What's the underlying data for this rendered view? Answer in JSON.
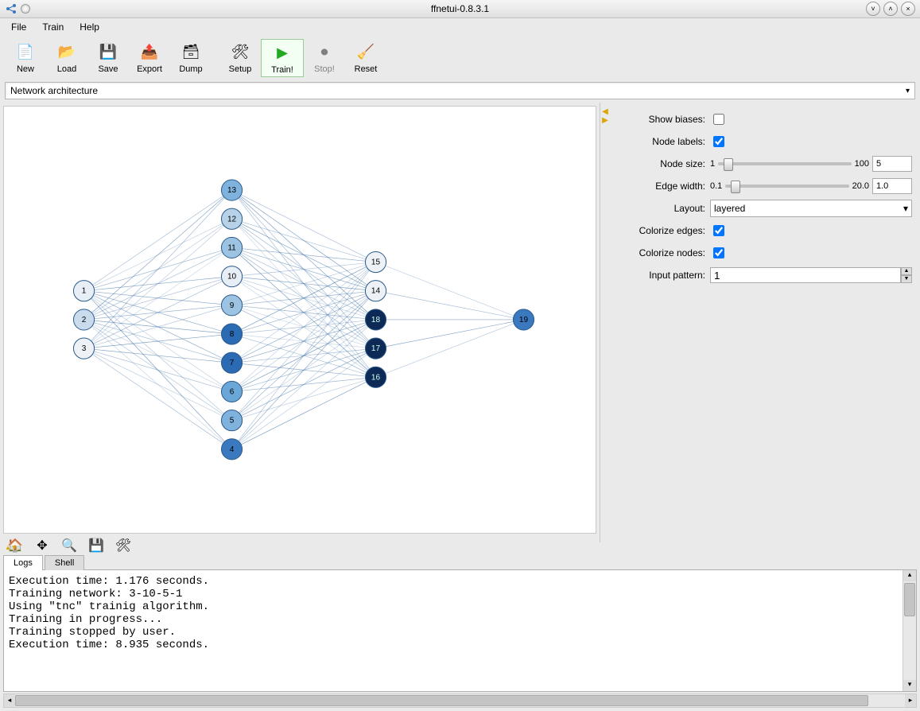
{
  "title": "ffnetui-0.8.3.1",
  "menu": {
    "file": "File",
    "train": "Train",
    "help": "Help"
  },
  "toolbar": {
    "new": "New",
    "load": "Load",
    "save": "Save",
    "export": "Export",
    "dump": "Dump",
    "setup": "Setup",
    "train": "Train!",
    "stop": "Stop!",
    "reset": "Reset"
  },
  "view_selector": "Network architecture",
  "props": {
    "show_biases": {
      "label": "Show biases:",
      "checked": false
    },
    "node_labels": {
      "label": "Node labels:",
      "checked": true
    },
    "node_size": {
      "label": "Node size:",
      "min": "1",
      "max": "100",
      "value": "5"
    },
    "edge_width": {
      "label": "Edge width:",
      "min": "0.1",
      "max": "20.0",
      "value": "1.0"
    },
    "layout": {
      "label": "Layout:",
      "value": "layered"
    },
    "colorize_edges": {
      "label": "Colorize edges:",
      "checked": true
    },
    "colorize_nodes": {
      "label": "Colorize nodes:",
      "checked": true
    },
    "input_pattern": {
      "label": "Input pattern:",
      "value": "1"
    }
  },
  "tabs": {
    "logs": "Logs",
    "shell": "Shell"
  },
  "log": "Execution time: 1.176 seconds.\nTraining network: 3-10-5-1\nUsing \"tnc\" trainig algorithm.\nTraining in progress...\nTraining stopped by user.\nExecution time: 8.935 seconds.",
  "chart_data": {
    "type": "network",
    "layers": [
      {
        "nodes": [
          {
            "id": 1
          },
          {
            "id": 2
          },
          {
            "id": 3
          }
        ]
      },
      {
        "nodes": [
          {
            "id": 4
          },
          {
            "id": 5
          },
          {
            "id": 6
          },
          {
            "id": 7
          },
          {
            "id": 8
          },
          {
            "id": 9
          },
          {
            "id": 10
          },
          {
            "id": 11
          },
          {
            "id": 12
          },
          {
            "id": 13
          }
        ]
      },
      {
        "nodes": [
          {
            "id": 14
          },
          {
            "id": 15
          },
          {
            "id": 16
          },
          {
            "id": 17
          },
          {
            "id": 18
          }
        ]
      },
      {
        "nodes": [
          {
            "id": 19
          }
        ]
      }
    ],
    "fully_connected_between_layers": true,
    "node_colors": {
      "1": "#e8eef5",
      "2": "#c9dbec",
      "3": "#eef2f7",
      "4": "#3a78bf",
      "5": "#7fb3dd",
      "6": "#6aa6d6",
      "7": "#2a6bb3",
      "8": "#2a6bb3",
      "9": "#9cc4e2",
      "10": "#e8eef5",
      "11": "#9cc4e2",
      "12": "#b6d1e8",
      "13": "#7fb3dd",
      "14": "#eef2f7",
      "15": "#eef2f7",
      "16": "#0c2a55",
      "17": "#0c2a55",
      "18": "#0c2a55",
      "19": "#3a78bf"
    }
  }
}
